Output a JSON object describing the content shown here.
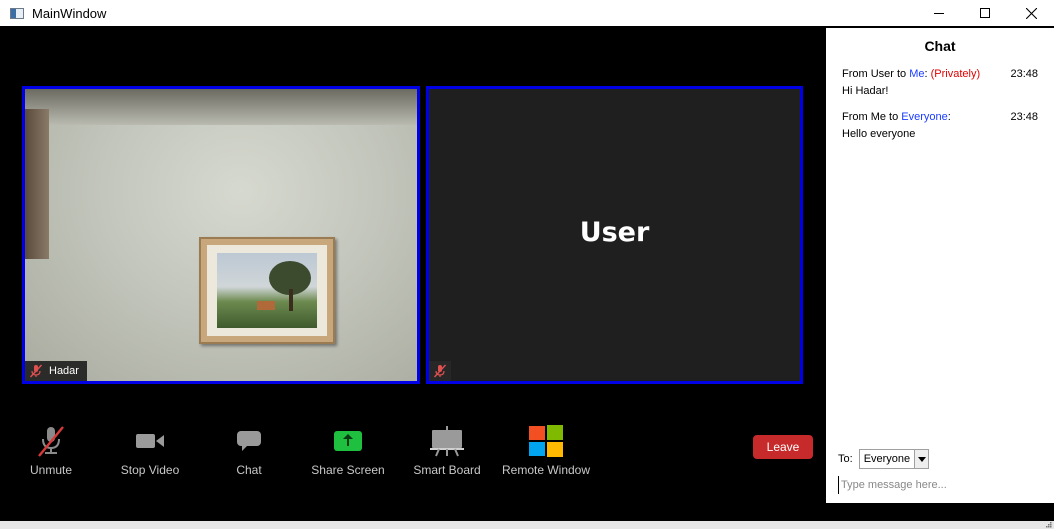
{
  "window": {
    "title": "MainWindow"
  },
  "participants": [
    {
      "name": "Hadar",
      "muted": true,
      "video": true
    },
    {
      "name": "User",
      "muted": true,
      "video": false
    }
  ],
  "toolbar": {
    "unmute_label": "Unmute",
    "stop_video_label": "Stop Video",
    "chat_label": "Chat",
    "share_screen_label": "Share Screen",
    "smart_board_label": "Smart Board",
    "remote_window_label": "Remote Window",
    "leave_label": "Leave"
  },
  "chat": {
    "title": "Chat",
    "messages": [
      {
        "from_prefix": "From User to ",
        "to": "Me",
        "suffix": ": ",
        "private": "(Privately)",
        "time": "23:48",
        "text": "Hi Hadar!"
      },
      {
        "from_prefix": "From Me to ",
        "to": "Everyone",
        "suffix": ":",
        "private": "",
        "time": "23:48",
        "text": "Hello everyone"
      }
    ],
    "to_label": "To:",
    "to_value": "Everyone",
    "input_placeholder": "Type message here..."
  },
  "colors": {
    "tile_border": "#0000e6",
    "leave": "#c62a2a",
    "share_green": "#1fbf3f",
    "recipient_blue": "#1a3cff",
    "private_red": "#e00000"
  }
}
